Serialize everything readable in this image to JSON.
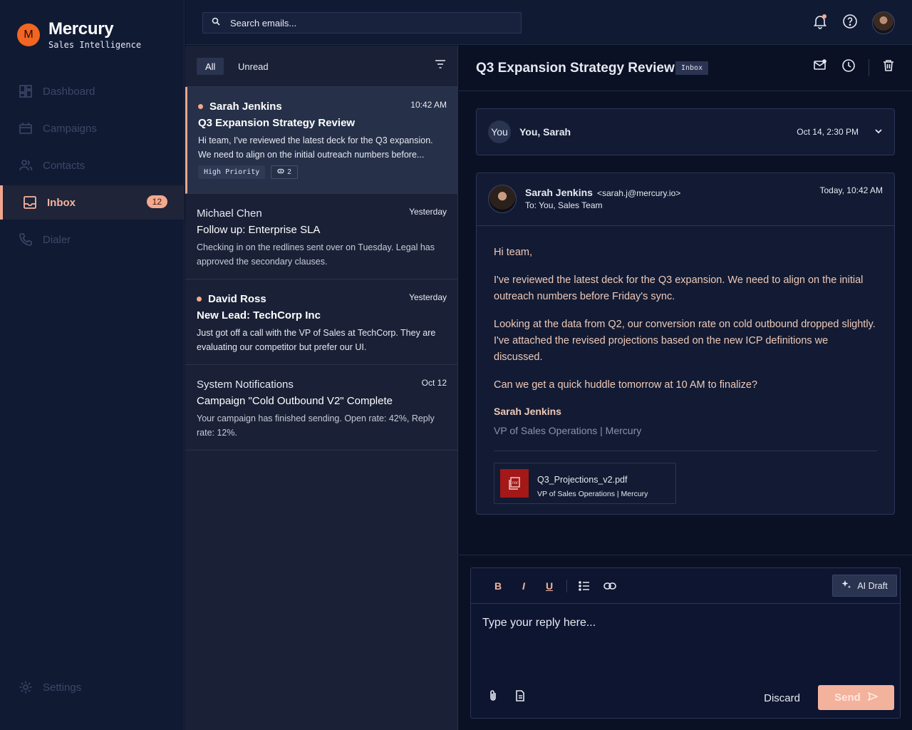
{
  "brand": {
    "logo_letter": "M",
    "name": "Mercury",
    "subtitle": "Sales Intelligence"
  },
  "nav": {
    "items": [
      {
        "label": "Dashboard",
        "icon": "dashboard-icon"
      },
      {
        "label": "Campaigns",
        "icon": "campaigns-icon"
      },
      {
        "label": "Contacts",
        "icon": "contacts-icon"
      },
      {
        "label": "Inbox",
        "icon": "inbox-icon",
        "badge": "12",
        "active": true
      },
      {
        "label": "Dialer",
        "icon": "phone-icon"
      }
    ],
    "settings_label": "Settings"
  },
  "search": {
    "placeholder": "Search emails..."
  },
  "list": {
    "filters": {
      "all": "All",
      "unread": "Unread"
    },
    "messages": [
      {
        "sender": "Sarah Jenkins",
        "time": "10:42 AM",
        "subject": "Q3 Expansion Strategy Review",
        "preview": "Hi team, I've reviewed the latest deck for the Q3 expansion. We need to align on the initial outreach numbers before...",
        "unread": true,
        "tag": "High Priority",
        "attachments": "2"
      },
      {
        "sender": "Michael Chen",
        "time": "Yesterday",
        "subject": "Follow up: Enterprise SLA",
        "preview": "Checking in on the redlines sent over on Tuesday. Legal has approved the secondary clauses.",
        "unread": false
      },
      {
        "sender": "David Ross",
        "time": "Yesterday",
        "subject": "New Lead: TechCorp Inc",
        "preview": "Just got off a call with the VP of Sales at TechCorp. They are evaluating our competitor but prefer our UI.",
        "unread": true
      },
      {
        "sender": "System Notifications",
        "time": "Oct 12",
        "subject": "Campaign \"Cold Outbound V2\" Complete",
        "preview": "Your campaign has finished sending. Open rate: 42%, Reply rate: 12%.",
        "unread": false
      }
    ]
  },
  "reader": {
    "title": "Q3 Expansion Strategy Review",
    "folder_tag": "Inbox",
    "thread": {
      "avatar": "You",
      "participants": "You, Sarah",
      "date": "Oct 14, 2:30 PM"
    },
    "email": {
      "from_name": "Sarah Jenkins",
      "from_email": "<sarah.j@mercury.io>",
      "to": "To: You, Sales Team",
      "date": "Today, 10:42 AM",
      "greeting": "Hi team,",
      "para1": "I've reviewed the latest deck for the Q3 expansion. We need to align on the initial outreach numbers before Friday's sync.",
      "para2": "Looking at the data from Q2, our conversion rate on cold outbound dropped slightly. I've attached the revised projections based on the new ICP definitions we discussed.",
      "para3": "Can we get a quick huddle tomorrow at 10 AM to finalize?",
      "sig_name": "Sarah Jenkins",
      "sig_role": "VP of Sales Operations | Mercury",
      "attachment_name": "Q3_Projections_v2.pdf",
      "attachment_sub": "VP of Sales Operations | Mercury"
    }
  },
  "composer": {
    "bold": "B",
    "italic": "I",
    "underline": "U",
    "ai_label": "AI Draft",
    "placeholder": "Type your reply here...",
    "discard": "Discard",
    "send": "Send"
  },
  "colors": {
    "accent": "#f3a98e",
    "background": "#0b1124",
    "sidebar": "#111a33",
    "pdf": "#a41818"
  }
}
